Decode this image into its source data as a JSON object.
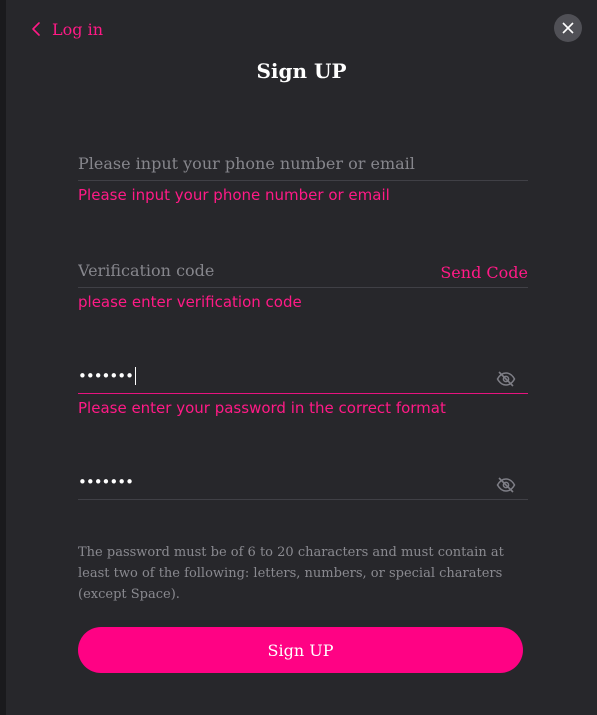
{
  "header": {
    "back_label": "Log in",
    "title": "Sign UP"
  },
  "fields": {
    "account": {
      "placeholder": "Please input your phone number or email",
      "value": "",
      "error": "Please input your phone number or email"
    },
    "code": {
      "placeholder": "Verification code",
      "value": "",
      "send_code_label": "Send Code",
      "error": "please enter verification code"
    },
    "password": {
      "masked_value": "•••••••",
      "error": "Please enter your password in the correct format"
    },
    "confirm_password": {
      "masked_value": "•••••••"
    }
  },
  "hint": "The password must be of 6 to 20 characters and must contain at least two of the following: letters, numbers, or special charaters (except Space).",
  "submit_label": "Sign UP",
  "colors": {
    "accent": "#ff0284",
    "background": "#27272b",
    "error": "#ff1a86"
  }
}
